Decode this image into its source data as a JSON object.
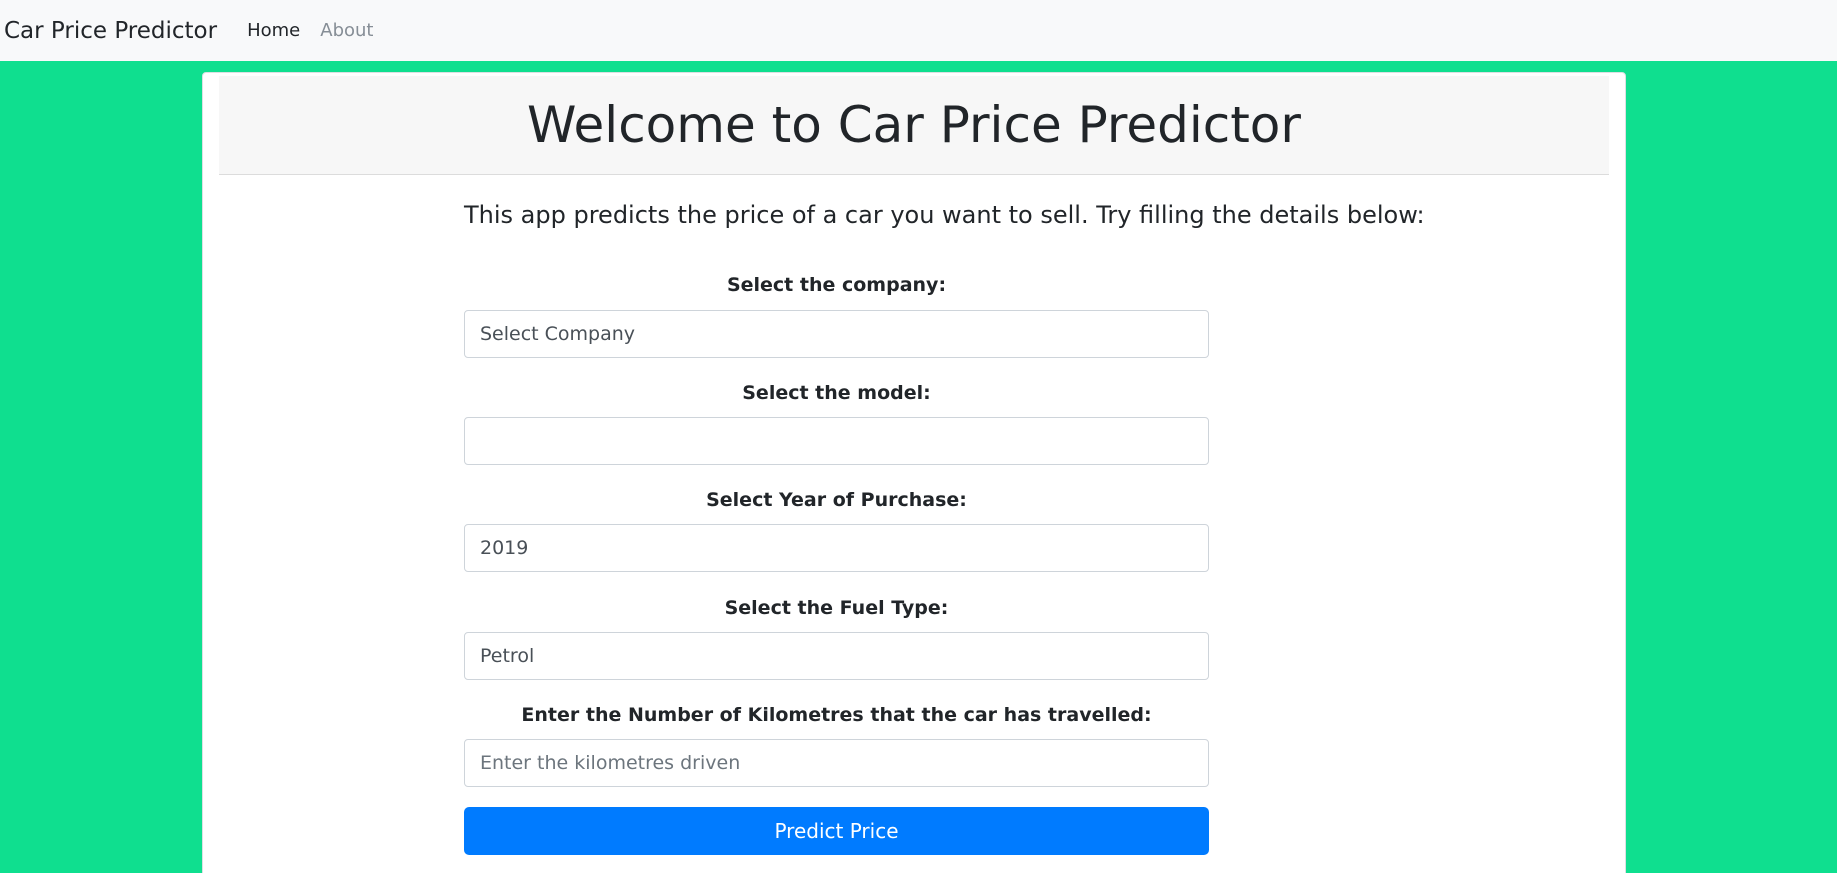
{
  "navbar": {
    "brand": "Car Price Predictor",
    "links": [
      {
        "label": "Home",
        "active": true
      },
      {
        "label": "About",
        "active": false
      }
    ]
  },
  "header": {
    "title": "Welcome to Car Price Predictor"
  },
  "intro": "This app predicts the price of a car you want to sell. Try filling the details below:",
  "form": {
    "company": {
      "label": "Select the company:",
      "value": "Select Company"
    },
    "model": {
      "label": "Select the model:",
      "value": ""
    },
    "year": {
      "label": "Select Year of Purchase:",
      "value": "2019"
    },
    "fuel": {
      "label": "Select the Fuel Type:",
      "value": "Petrol"
    },
    "kms": {
      "label": "Enter the Number of Kilometres that the car has travelled:",
      "placeholder": "Enter the kilometres driven"
    },
    "submit_label": "Predict Price"
  },
  "colors": {
    "background": "#0fdf8f",
    "navbar": "#f8f9fa",
    "button": "#007bff"
  }
}
